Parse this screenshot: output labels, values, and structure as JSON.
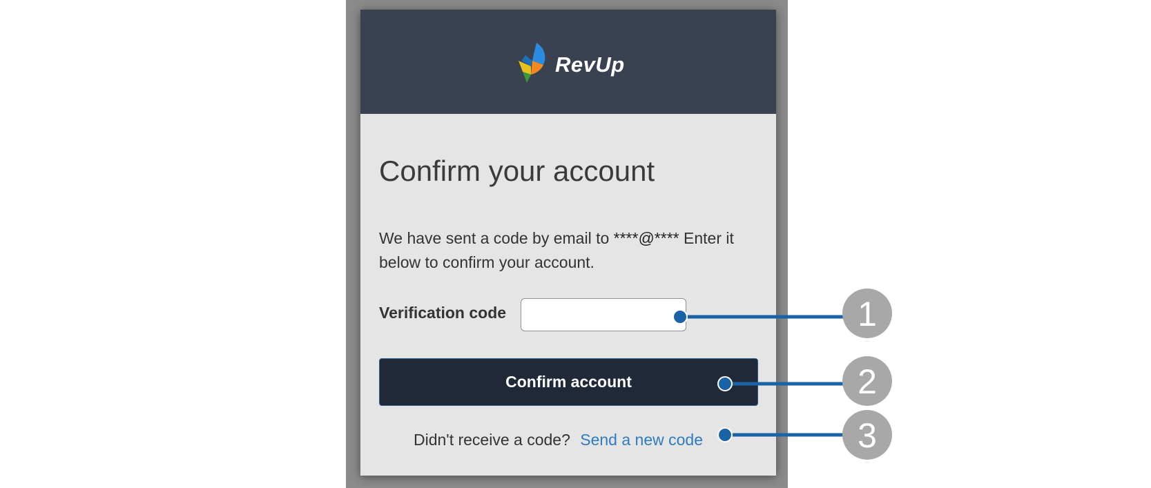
{
  "header": {
    "brand_name": "RevUp"
  },
  "form": {
    "title": "Confirm your account",
    "description_prefix": "We have sent a code by email to",
    "masked_email": "****@****",
    "description_suffix": "Enter it below to confirm your account.",
    "verification_label": "Verification code",
    "verification_value": "",
    "confirm_button_label": "Confirm account",
    "resend_prompt": "Didn't receive a code?",
    "resend_link_label": "Send a new code"
  },
  "callouts": {
    "one": "1",
    "two": "2",
    "three": "3"
  },
  "colors": {
    "header_bg": "#3a4150",
    "card_bg": "#e5e5e5",
    "button_bg": "#212838",
    "link": "#2f7bbf",
    "callout_line": "#1a63a6",
    "callout_circle": "#a8a8a8"
  }
}
